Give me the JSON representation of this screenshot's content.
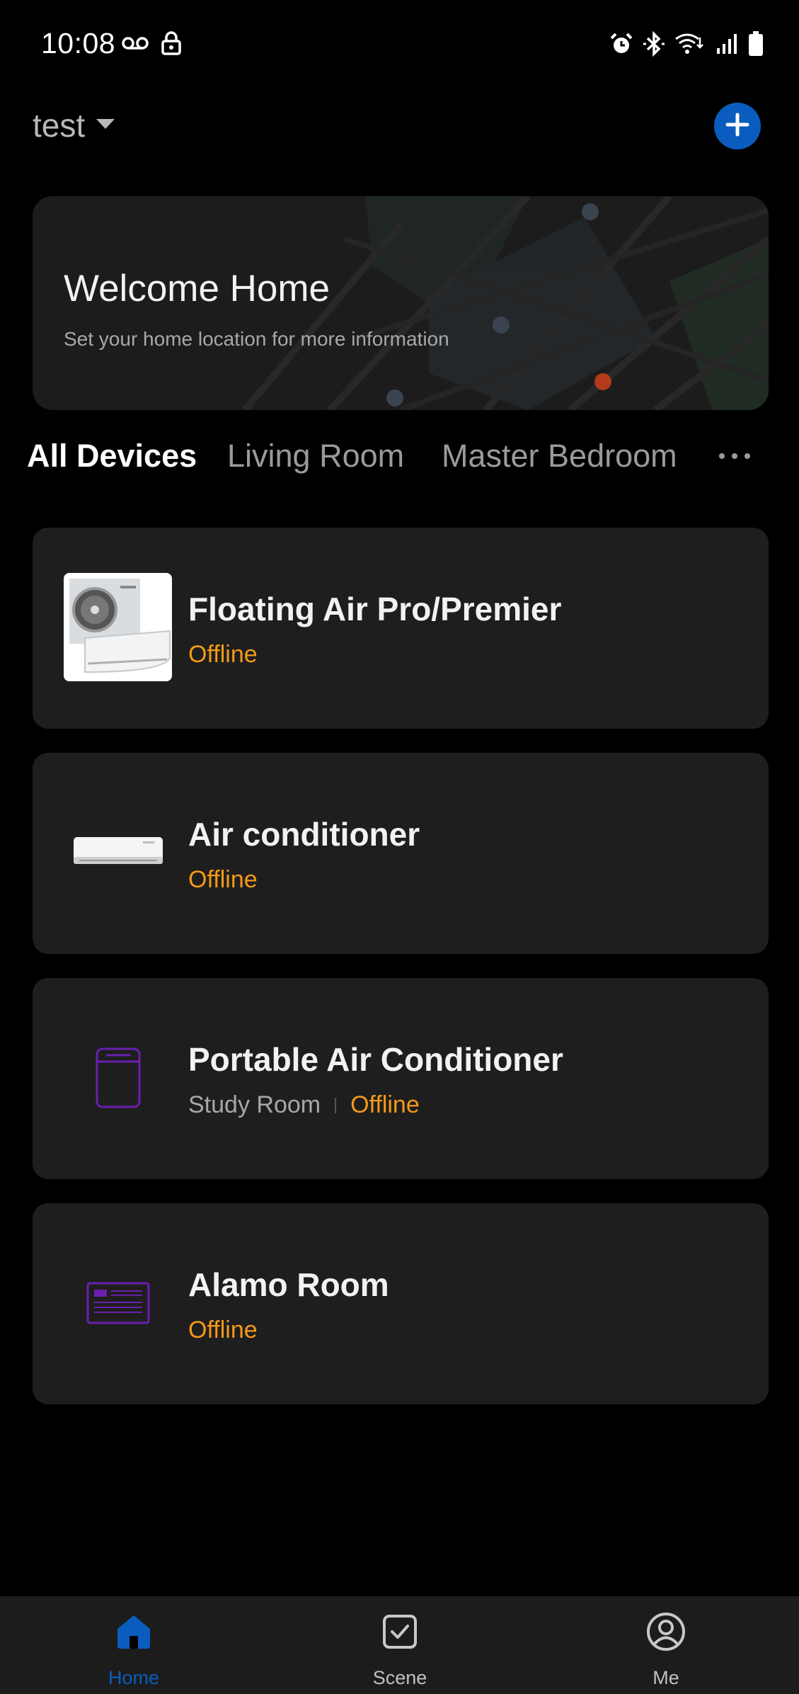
{
  "status_bar": {
    "time": "10:08",
    "left_icons": [
      "voicemail-icon",
      "lock-icon"
    ],
    "right_icons": [
      "alarm-icon",
      "bluetooth-icon",
      "wifi-icon",
      "signal-icon",
      "battery-icon"
    ]
  },
  "header": {
    "home_name": "test",
    "add_icon": "plus-icon",
    "accent_color": "#0a5dbf"
  },
  "welcome": {
    "title": "Welcome Home",
    "subtitle": "Set your home location for more information"
  },
  "tabs": [
    {
      "label": "All Devices",
      "active": true
    },
    {
      "label": "Living Room",
      "active": false
    },
    {
      "label": "Master Bedroom",
      "active": false
    }
  ],
  "devices": [
    {
      "name": "Floating Air Pro/Premier",
      "room": "",
      "status": "Offline",
      "icon": "split-unit-photo-icon"
    },
    {
      "name": "Air conditioner",
      "room": "",
      "status": "Offline",
      "icon": "wall-ac-icon"
    },
    {
      "name": "Portable Air Conditioner",
      "room": "Study Room",
      "status": "Offline",
      "icon": "portable-ac-icon"
    },
    {
      "name": "Alamo Room",
      "room": "",
      "status": "Offline",
      "icon": "window-ac-icon"
    }
  ],
  "status_color": "#f29a18",
  "bottom_nav": [
    {
      "label": "Home",
      "icon": "home-icon",
      "active": true
    },
    {
      "label": "Scene",
      "icon": "scene-checkbox-icon",
      "active": false
    },
    {
      "label": "Me",
      "icon": "profile-icon",
      "active": false
    }
  ]
}
